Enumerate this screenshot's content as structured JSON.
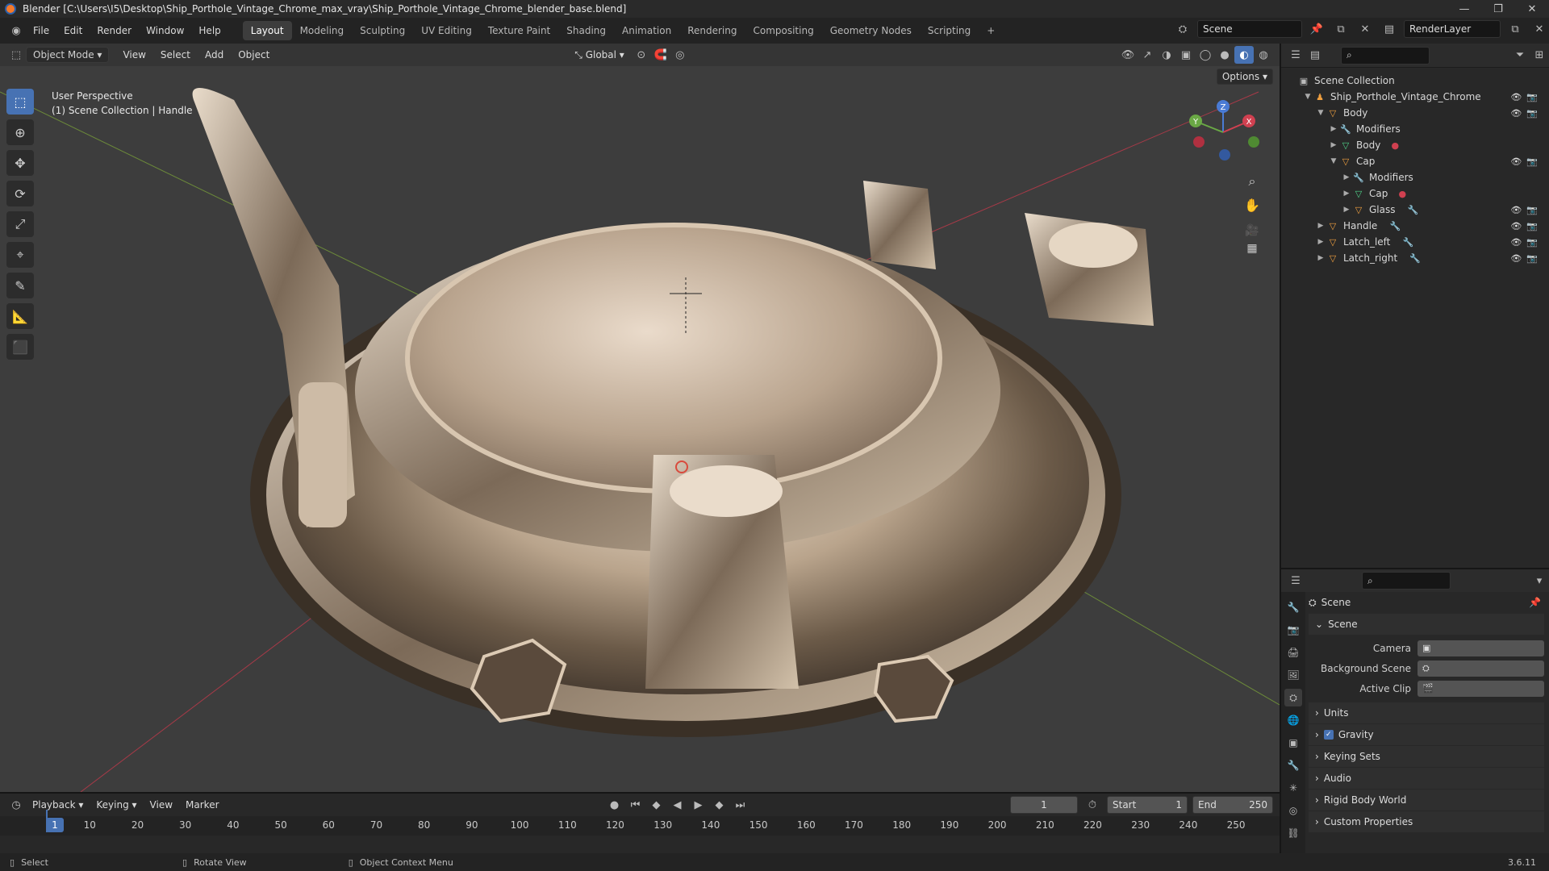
{
  "title": "Blender [C:\\Users\\I5\\Desktop\\Ship_Porthole_Vintage_Chrome_max_vray\\Ship_Porthole_Vintage_Chrome_blender_base.blend]",
  "menu": [
    "File",
    "Edit",
    "Render",
    "Window",
    "Help"
  ],
  "workspaces": [
    "Layout",
    "Modeling",
    "Sculpting",
    "UV Editing",
    "Texture Paint",
    "Shading",
    "Animation",
    "Rendering",
    "Compositing",
    "Geometry Nodes",
    "Scripting"
  ],
  "active_workspace": "Layout",
  "scene_name": "Scene",
  "view_layer": "RenderLayer",
  "viewport": {
    "mode": "Object Mode",
    "menus": [
      "View",
      "Select",
      "Add",
      "Object"
    ],
    "orientation": "Global",
    "options_label": "Options",
    "info_line1": "User Perspective",
    "info_line2": "(1) Scene Collection | Handle",
    "gizmo": {
      "x": "X",
      "y": "Y",
      "z": "Z"
    }
  },
  "outliner": {
    "root": "Scene Collection",
    "items": [
      {
        "label": "Ship_Porthole_Vintage_Chrome",
        "icon": "collection-icon"
      },
      {
        "label": "Body",
        "icon": "object-icon"
      },
      {
        "label": "Modifiers",
        "icon": "modifier-icon"
      },
      {
        "label": "Body",
        "icon": "mesh-icon"
      },
      {
        "label": "Cap",
        "icon": "object-icon"
      },
      {
        "label": "Modifiers",
        "icon": "modifier-icon"
      },
      {
        "label": "Cap",
        "icon": "mesh-icon"
      },
      {
        "label": "Glass",
        "icon": "object-icon"
      },
      {
        "label": "Handle",
        "icon": "object-icon"
      },
      {
        "label": "Latch_left",
        "icon": "object-icon"
      },
      {
        "label": "Latch_right",
        "icon": "object-icon"
      }
    ]
  },
  "properties": {
    "context": "Scene",
    "panel": "Scene",
    "camera_label": "Camera",
    "background_scene_label": "Background Scene",
    "active_clip_label": "Active Clip",
    "sections": [
      "Units",
      "Gravity",
      "Keying Sets",
      "Audio",
      "Rigid Body World",
      "Custom Properties"
    ]
  },
  "timeline": {
    "menus": [
      "Playback",
      "Keying",
      "View",
      "Marker"
    ],
    "current_frame": "1",
    "start_label": "Start",
    "start": "1",
    "end_label": "End",
    "end": "250",
    "ticks": [
      "10",
      "20",
      "30",
      "40",
      "50",
      "60",
      "70",
      "80",
      "90",
      "100",
      "110",
      "120",
      "130",
      "140",
      "150",
      "160",
      "170",
      "180",
      "190",
      "200",
      "210",
      "220",
      "230",
      "240",
      "250"
    ]
  },
  "status": {
    "select": "Select",
    "rotate": "Rotate View",
    "context_menu": "Object Context Menu",
    "version": "3.6.11"
  }
}
